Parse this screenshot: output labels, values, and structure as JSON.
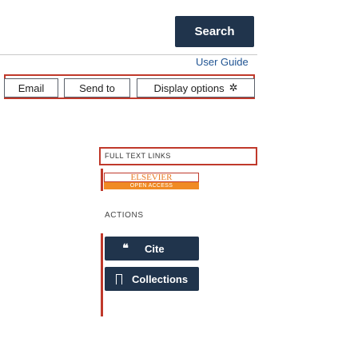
{
  "search": {
    "button_label": "Search"
  },
  "header": {
    "user_guide_label": "User Guide"
  },
  "action_bar": {
    "email_label": "Email",
    "send_to_label": "Send to",
    "display_options_label": "Display options"
  },
  "full_text_links": {
    "label": "Full text links",
    "provider_name": "ELSEVIER",
    "provider_badge": "Open Access"
  },
  "actions": {
    "label": "Actions",
    "cite_label": "Cite",
    "collections_label": "Collections"
  },
  "icons": {
    "display_options": "gear-icon",
    "cite": "quote-icon",
    "collections": "bookmark-icon"
  },
  "colors": {
    "primary_button": "#20344c",
    "link": "#205493",
    "highlight_border": "#c0392b",
    "elsevier_orange": "#f08a24"
  }
}
